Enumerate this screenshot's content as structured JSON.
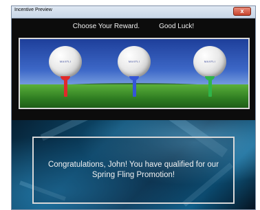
{
  "window": {
    "title": "Incentive Preview",
    "close_label": "x"
  },
  "header": {
    "choose": "Choose Your Reward.",
    "luck": "Good Luck!"
  },
  "rewards": [
    {
      "logo": "MAXFLI",
      "tee_color": "#e02a2a"
    },
    {
      "logo": "MAXFLI",
      "tee_color": "#3556d6"
    },
    {
      "logo": "MAXFLI",
      "tee_color": "#2fb44a"
    }
  ],
  "message": {
    "text": "Congratulations, John! You have qualified for our Spring Fling Promotion!"
  }
}
